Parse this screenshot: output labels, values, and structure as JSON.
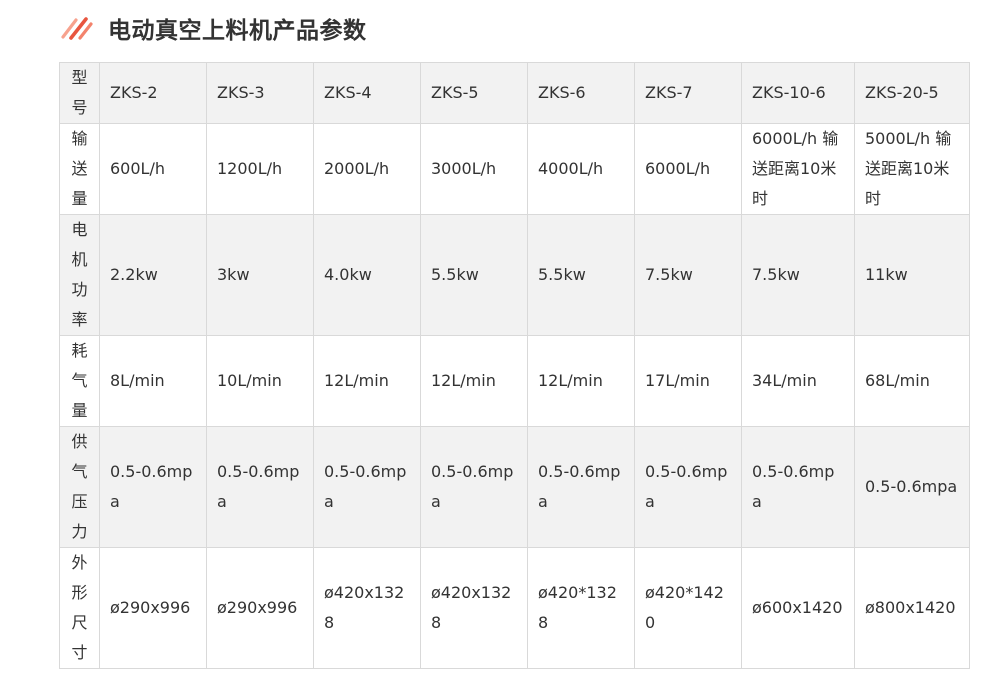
{
  "title": "电动真空上料机产品参数",
  "accent_colors": [
    "#e8553f",
    "#f7a28e"
  ],
  "table": {
    "rows": [
      {
        "label": "型号",
        "cells": [
          "ZKS-2",
          "ZKS-3",
          "ZKS-4",
          "ZKS-5",
          "ZKS-6",
          "ZKS-7",
          "ZKS-10-6",
          "ZKS-20-5"
        ]
      },
      {
        "label": "输送量",
        "cells": [
          "600L/h",
          "1200L/h",
          "2000L/h",
          "3000L/h",
          "4000L/h",
          "6000L/h",
          "6000L/h 输送距离10米时",
          "5000L/h 输送距离10米时"
        ]
      },
      {
        "label": "电机功率",
        "cells": [
          "2.2kw",
          "3kw",
          "4.0kw",
          "5.5kw",
          "5.5kw",
          "7.5kw",
          "7.5kw",
          "11kw"
        ]
      },
      {
        "label": "耗气量",
        "cells": [
          "8L/min",
          "10L/min",
          "12L/min",
          "12L/min",
          "12L/min",
          "17L/min",
          "34L/min",
          "68L/min"
        ]
      },
      {
        "label": "供气压力",
        "cells": [
          "0.5-0.6mpa",
          "0.5-0.6mpa",
          "0.5-0.6mpa",
          "0.5-0.6mpa",
          "0.5-0.6mpa",
          "0.5-0.6mpa",
          "0.5-0.6mpa",
          "0.5-0.6mpa"
        ]
      },
      {
        "label": "外形尺寸",
        "cells": [
          "ø290x996",
          "ø290x996",
          "ø420x1328",
          "ø420x1328",
          "ø420*1328",
          "ø420*1420",
          "ø600x1420",
          "ø800x1420"
        ]
      }
    ]
  }
}
